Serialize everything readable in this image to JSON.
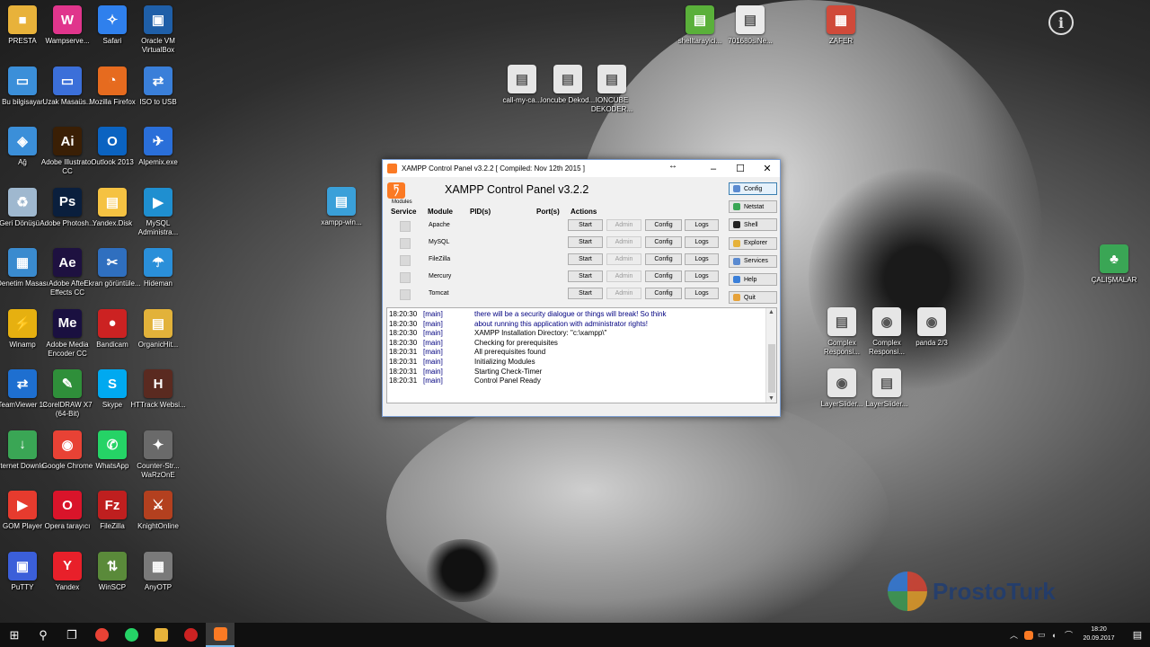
{
  "desktop": {
    "icons_col1": [
      {
        "label": "PRESTA",
        "color": "#e8b23a",
        "glyph": "■"
      },
      {
        "label": "Bu bilgisayar",
        "color": "#3b8fd9",
        "glyph": "▭"
      },
      {
        "label": "Ağ",
        "color": "#3b8fd9",
        "glyph": "◈"
      },
      {
        "label": "Geri Dönüşü...",
        "color": "#9fb8cf",
        "glyph": "♻"
      },
      {
        "label": "Denetim Masası",
        "color": "#3a8bcf",
        "glyph": "▦"
      },
      {
        "label": "Winamp",
        "color": "#e6b010",
        "glyph": "⚡"
      },
      {
        "label": "TeamViewer 12",
        "color": "#1e6fd0",
        "glyph": "⇄"
      },
      {
        "label": "Internet Downlo...",
        "color": "#3aa655",
        "glyph": "↓"
      },
      {
        "label": "GOM Player",
        "color": "#e63b2e",
        "glyph": "▶"
      },
      {
        "label": "PuTTY",
        "color": "#3b5fd9",
        "glyph": "▣"
      }
    ],
    "icons_col2": [
      {
        "label": "Wampserve...",
        "color": "#e0358c",
        "glyph": "W"
      },
      {
        "label": "Uzak Masaüs...",
        "color": "#3b6fd9",
        "glyph": "▭"
      },
      {
        "label": "Adobe Illustrator CC",
        "color": "#3a1f05",
        "glyph": "Ai"
      },
      {
        "label": "Adobe Photosh...",
        "color": "#0a1f3d",
        "glyph": "Ps"
      },
      {
        "label": "Adobe After Effects CC",
        "color": "#1e1140",
        "glyph": "Ae"
      },
      {
        "label": "Adobe Media Encoder CC",
        "color": "#1a1040",
        "glyph": "Me"
      },
      {
        "label": "CorelDRAW X7 (64-Bit)",
        "color": "#2f8f3a",
        "glyph": "✎"
      },
      {
        "label": "Google Chrome",
        "color": "#e84235",
        "glyph": "◉"
      },
      {
        "label": "Opera tarayıcı",
        "color": "#d9142a",
        "glyph": "O"
      },
      {
        "label": "Yandex",
        "color": "#e8202a",
        "glyph": "Y"
      }
    ],
    "icons_col3": [
      {
        "label": "Safari",
        "color": "#2f80ed",
        "glyph": "✧"
      },
      {
        "label": "Mozilla Firefox",
        "color": "#e66b1f",
        "glyph": "◔"
      },
      {
        "label": "Outlook 2013",
        "color": "#0b63c1",
        "glyph": "O"
      },
      {
        "label": "Yandex.Disk",
        "color": "#f5c242",
        "glyph": "▤"
      },
      {
        "label": "Ekran görüntüle...",
        "color": "#2f6fbf",
        "glyph": "✂"
      },
      {
        "label": "Bandicam",
        "color": "#cc2222",
        "glyph": "●"
      },
      {
        "label": "Skype",
        "color": "#00a9f0",
        "glyph": "S"
      },
      {
        "label": "WhatsApp",
        "color": "#25d366",
        "glyph": "✆"
      },
      {
        "label": "FileZilla",
        "color": "#bf1f1f",
        "glyph": "Fz"
      },
      {
        "label": "WinSCP",
        "color": "#5a8a3a",
        "glyph": "⇅"
      }
    ],
    "icons_col4": [
      {
        "label": "Oracle VM VirtualBox",
        "color": "#1f5fa8",
        "glyph": "▣"
      },
      {
        "label": "ISO to USB",
        "color": "#3a7fd9",
        "glyph": "⇄"
      },
      {
        "label": "Alpemix.exe",
        "color": "#2a6fd9",
        "glyph": "✈"
      },
      {
        "label": "MySQL Administra...",
        "color": "#1f8fd0",
        "glyph": "▶"
      },
      {
        "label": "Hideman",
        "color": "#2a8fd9",
        "glyph": "☂"
      },
      {
        "label": "OrganicHit...",
        "color": "#e2b23a",
        "glyph": "▤"
      },
      {
        "label": "HTTrack Websi...",
        "color": "#5a2a20",
        "glyph": "H"
      },
      {
        "label": "Counter-Str... WaRzOnE",
        "color": "#6a6a6a",
        "glyph": "✦"
      },
      {
        "label": "KnightOnline",
        "color": "#b3401f",
        "glyph": "⚔"
      },
      {
        "label": "AnyOTP",
        "color": "#7a7a7a",
        "glyph": "▦"
      }
    ],
    "icons_free": [
      {
        "label": "shelltarayici...",
        "color": "#5ab03a",
        "glyph": "▤"
      },
      {
        "label": "701680siNe...",
        "color": "#eaeaea",
        "glyph": "▤"
      },
      {
        "label": "ZAFER",
        "color": "#d04a3a",
        "glyph": "▦"
      },
      {
        "label": "call-my-ca...",
        "color": "#e6e6e6",
        "glyph": "▤"
      },
      {
        "label": "Ioncube Dekod...",
        "color": "#e6e6e6",
        "glyph": "▤"
      },
      {
        "label": "IONCUBE DEKODER...",
        "color": "#e6e6e6",
        "glyph": "▤"
      },
      {
        "label": "xampp-win...",
        "color": "#3aa0d9",
        "glyph": "▤"
      },
      {
        "label": "ÇALIŞMALAR",
        "color": "#3aa655",
        "glyph": "♣"
      },
      {
        "label": "Complex Responsi...",
        "color": "#e6e6e6",
        "glyph": "▤"
      },
      {
        "label": "Complex Responsi...",
        "color": "#e6e6e6",
        "glyph": "◉"
      },
      {
        "label": "panda 2/3",
        "color": "#e6e6e6",
        "glyph": "◉"
      },
      {
        "label": "LayerSlider...",
        "color": "#e6e6e6",
        "glyph": "◉"
      },
      {
        "label": "LayerSlider...",
        "color": "#e6e6e6",
        "glyph": "▤"
      }
    ],
    "info_glyph": "i"
  },
  "xampp": {
    "window_title": "XAMPP Control Panel v3.2.2   [ Compiled: Nov 12th 2015 ]",
    "title": "XAMPP Control Panel v3.2.2",
    "modules_label": "Modules",
    "headers": {
      "service": "Service",
      "module": "Module",
      "pids": "PID(s)",
      "ports": "Port(s)",
      "actions": "Actions"
    },
    "modules": [
      {
        "name": "Apache",
        "start": "Start",
        "admin": "Admin",
        "config": "Config",
        "logs": "Logs"
      },
      {
        "name": "MySQL",
        "start": "Start",
        "admin": "Admin",
        "config": "Config",
        "logs": "Logs"
      },
      {
        "name": "FileZilla",
        "start": "Start",
        "admin": "Admin",
        "config": "Config",
        "logs": "Logs"
      },
      {
        "name": "Mercury",
        "start": "Start",
        "admin": "Admin",
        "config": "Config",
        "logs": "Logs"
      },
      {
        "name": "Tomcat",
        "start": "Start",
        "admin": "Admin",
        "config": "Config",
        "logs": "Logs"
      }
    ],
    "side_buttons": [
      {
        "label": "Config",
        "color": "#5a8ad0"
      },
      {
        "label": "Netstat",
        "color": "#3aa655"
      },
      {
        "label": "Shell",
        "color": "#222222"
      },
      {
        "label": "Explorer",
        "color": "#e6b23a"
      },
      {
        "label": "Services",
        "color": "#5a8ad0"
      },
      {
        "label": "Help",
        "color": "#3a7fd9"
      },
      {
        "label": "Quit",
        "color": "#e6a23a"
      }
    ],
    "log": [
      {
        "time": "18:20:30",
        "module": "[main]",
        "text": "there will be a security dialogue or things will break! So think",
        "color": "#000080"
      },
      {
        "time": "18:20:30",
        "module": "[main]",
        "text": "about running this application with administrator rights!",
        "color": "#000080"
      },
      {
        "time": "18:20:30",
        "module": "[main]",
        "text": "XAMPP Installation Directory: \"c:\\xampp\\\"",
        "color": "#000000"
      },
      {
        "time": "18:20:30",
        "module": "[main]",
        "text": "Checking for prerequisites",
        "color": "#000000"
      },
      {
        "time": "18:20:31",
        "module": "[main]",
        "text": "All prerequisites found",
        "color": "#000000"
      },
      {
        "time": "18:20:31",
        "module": "[main]",
        "text": "Initializing Modules",
        "color": "#000000"
      },
      {
        "time": "18:20:31",
        "module": "[main]",
        "text": "Starting Check-Timer",
        "color": "#000000"
      },
      {
        "time": "18:20:31",
        "module": "[main]",
        "text": "Control Panel Ready",
        "color": "#000000"
      }
    ]
  },
  "taskbar": {
    "time": "18:20",
    "date": "20.09.2017",
    "apps": [
      {
        "name": "chrome",
        "color": "#e84235"
      },
      {
        "name": "whatsapp",
        "color": "#25d366"
      },
      {
        "name": "explorer",
        "color": "#e6b23a"
      },
      {
        "name": "bandicam",
        "color": "#cc2222"
      },
      {
        "name": "xampp",
        "color": "#fb7a24"
      }
    ]
  },
  "watermark": {
    "text": "ProstoTurk"
  }
}
